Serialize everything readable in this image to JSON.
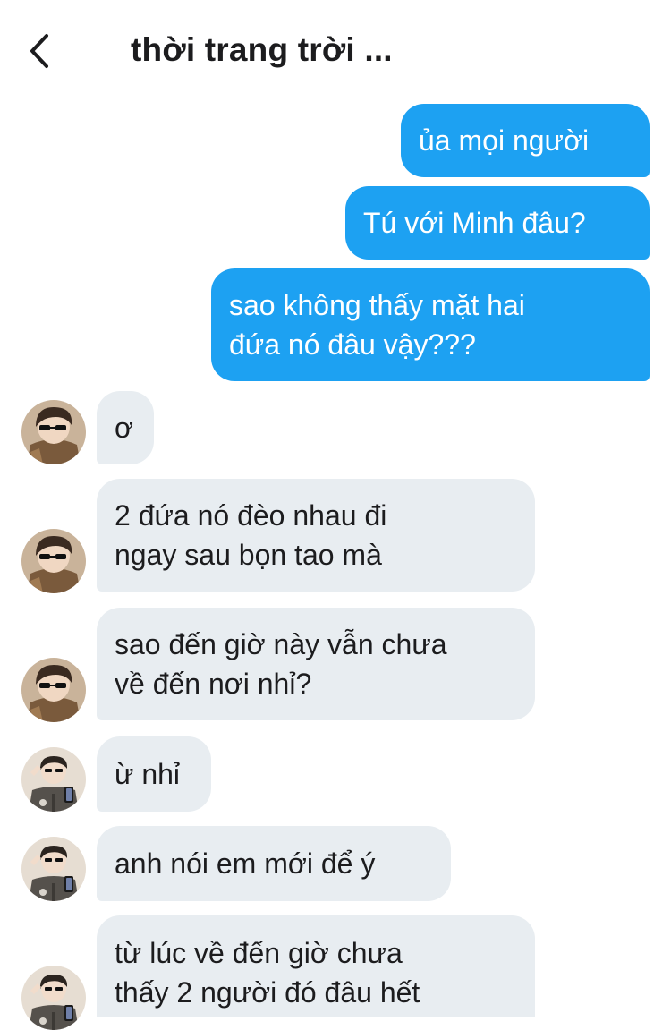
{
  "header": {
    "title": "thời trang trời ..."
  },
  "messages": [
    {
      "side": "out",
      "text": "ủa mọi người"
    },
    {
      "side": "out",
      "text": "Tú với Minh đâu?"
    },
    {
      "side": "out",
      "text": "sao không thấy mặt hai\nđứa nó đâu vậy???"
    },
    {
      "side": "in",
      "sender": "user-1",
      "text": "ơ"
    },
    {
      "side": "in",
      "sender": "user-1",
      "text": "2 đứa nó đèo nhau đi\nngay sau bọn tao mà"
    },
    {
      "side": "in",
      "sender": "user-1",
      "text": "sao đến giờ này vẫn chưa\nvề đến nơi nhỉ?"
    },
    {
      "side": "in",
      "sender": "user-2",
      "text": "ừ nhỉ"
    },
    {
      "side": "in",
      "sender": "user-2",
      "text": "anh nói em mới để ý"
    },
    {
      "side": "in",
      "sender": "user-2",
      "text": "từ lúc về đến giờ chưa\nthấy 2 người đó đâu hết"
    }
  ],
  "colors": {
    "outgoing": "#1da1f2",
    "incoming": "#e8edf1",
    "text": "#1c1c1e"
  }
}
